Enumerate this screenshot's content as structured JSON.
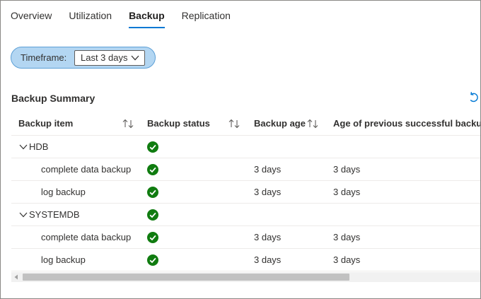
{
  "tabs": [
    {
      "label": "Overview",
      "active": false
    },
    {
      "label": "Utilization",
      "active": false
    },
    {
      "label": "Backup",
      "active": true
    },
    {
      "label": "Replication",
      "active": false
    }
  ],
  "filter": {
    "label": "Timeframe:",
    "value": "Last 3 days",
    "icon": "chevron-down-icon"
  },
  "summary": {
    "title": "Backup Summary",
    "refresh_icon": "refresh-icon"
  },
  "table": {
    "columns": [
      "Backup item",
      "Backup status",
      "Backup age",
      "Age of previous successful backup"
    ],
    "sortable_columns": [
      "Backup item",
      "Backup status",
      "Backup age"
    ],
    "status_color": "#107c10",
    "rows": [
      {
        "type": "group",
        "item": "HDB",
        "status": "success",
        "backup_age": "",
        "prev_age": ""
      },
      {
        "type": "child",
        "item": "complete data backup",
        "status": "success",
        "backup_age": "3 days",
        "prev_age": "3 days"
      },
      {
        "type": "child",
        "item": "log backup",
        "status": "success",
        "backup_age": "3 days",
        "prev_age": "3 days"
      },
      {
        "type": "group",
        "item": "SYSTEMDB",
        "status": "success",
        "backup_age": "",
        "prev_age": ""
      },
      {
        "type": "child",
        "item": "complete data backup",
        "status": "success",
        "backup_age": "3 days",
        "prev_age": "3 days"
      },
      {
        "type": "child",
        "item": "log backup",
        "status": "success",
        "backup_age": "3 days",
        "prev_age": "3 days"
      }
    ]
  },
  "colors": {
    "accent": "#0078d4",
    "pill_bg": "#b3d6f2",
    "success": "#107c10"
  }
}
